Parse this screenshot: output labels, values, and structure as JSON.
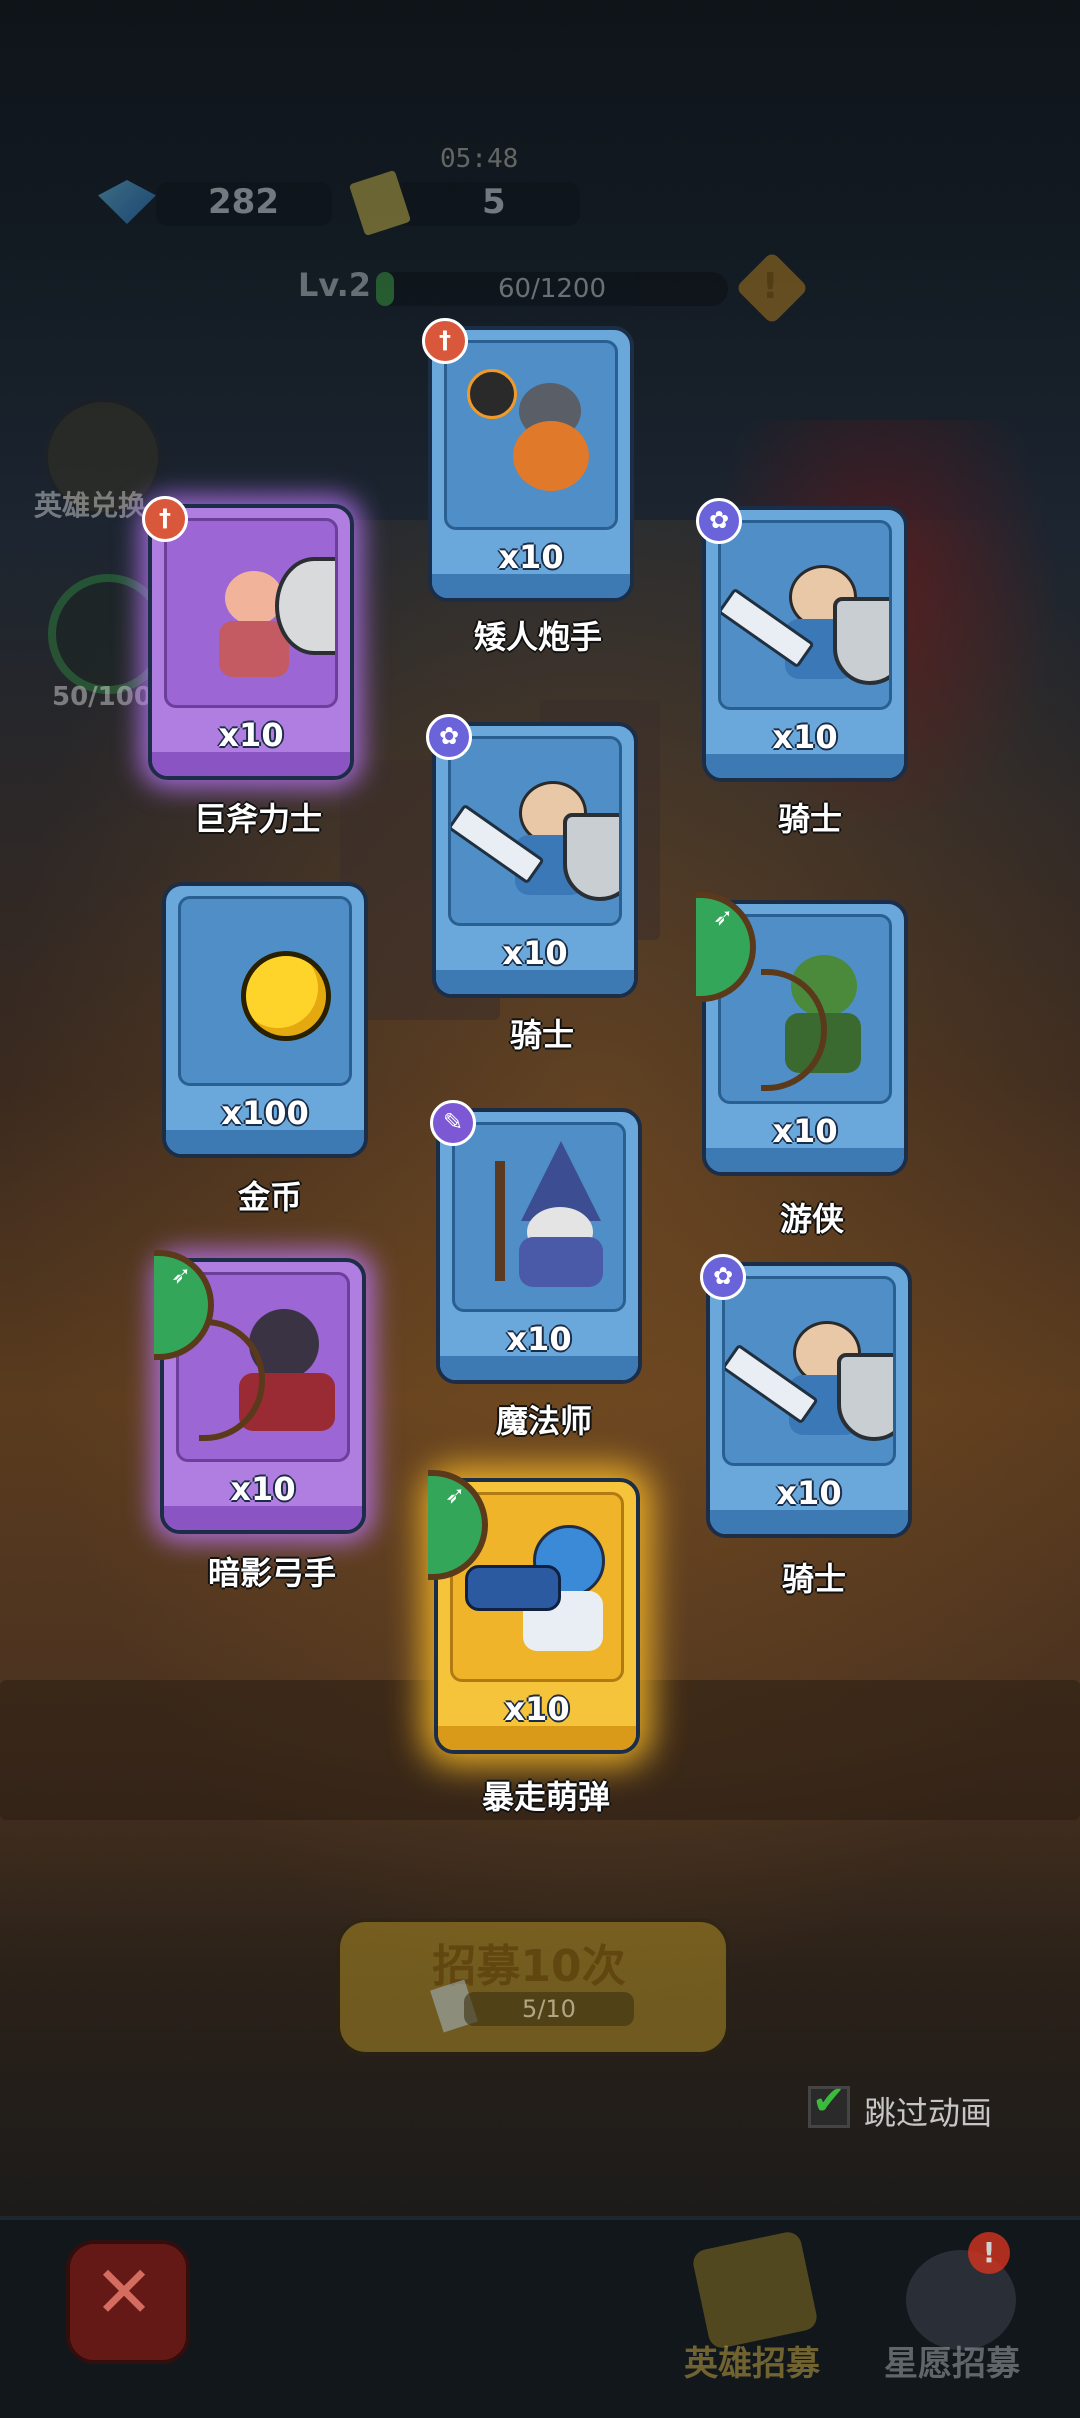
{
  "hud": {
    "timer": "05:48",
    "gems": "282",
    "tickets": "5",
    "level": "Lv.2",
    "xp": "60/1200",
    "xp_progress": 0.05,
    "warning_icon": "warning-icon"
  },
  "side": {
    "hero_exchange": "英雄兑换",
    "progress": "50/100"
  },
  "cards": [
    {
      "name": "矮人炮手",
      "count": "x10",
      "badge": "sword-class-icon"
    },
    {
      "name": "巨斧力士",
      "count": "x10",
      "badge": "sword-class-icon",
      "rarity": "epic"
    },
    {
      "name": "骑士",
      "count": "x10",
      "badge": "paw-class-icon"
    },
    {
      "name": "骑士",
      "count": "x10",
      "badge": "paw-class-icon"
    },
    {
      "name": "金币",
      "count": "x100"
    },
    {
      "name": "游侠",
      "count": "x10",
      "badge": "bow-class-icon"
    },
    {
      "name": "魔法师",
      "count": "x10",
      "badge": "wand-class-icon"
    },
    {
      "name": "暗影弓手",
      "count": "x10",
      "badge": "bow-class-icon",
      "rarity": "epic"
    },
    {
      "name": "骑士",
      "count": "x10",
      "badge": "paw-class-icon"
    },
    {
      "name": "暴走萌弹",
      "count": "x10",
      "badge": "bow-class-icon",
      "rarity": "legendary"
    }
  ],
  "recruit": {
    "label": "招募10次",
    "count": "5/10"
  },
  "skip": {
    "label": "跳过动画",
    "checked": true
  },
  "nav": {
    "hero_recruit": "英雄招募",
    "wish_recruit": "星愿招募",
    "alert": "!"
  },
  "colors": {
    "rare_card": "#6aa8dc",
    "epic_card": "#b07ee0",
    "legendary_card": "#f6c43b"
  }
}
